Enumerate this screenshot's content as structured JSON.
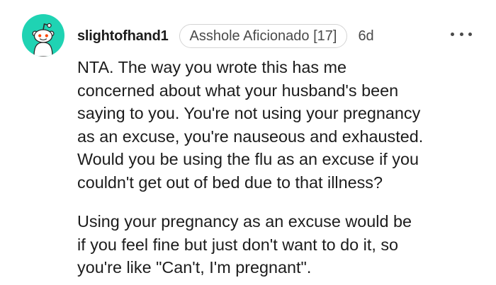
{
  "comment": {
    "author": "slightofhand1",
    "flair": "Asshole Aficionado [17]",
    "age": "6d",
    "more_icon": "more-options-icon",
    "avatar_icon": "snoo-avatar-icon",
    "avatar_color": "#1fd3b3",
    "paragraphs": [
      {
        "lines": [
          "NTA. The way you wrote this has me",
          "concerned about what your husband's been",
          "saying to you. You're not using your pregnancy",
          "as an excuse, you're nauseous and exhausted.",
          "Would you be using the flu as an excuse if you",
          "couldn't get out of bed due to that illness?"
        ]
      },
      {
        "lines": [
          "Using your pregnancy as an excuse would be",
          "if you feel fine but just don't want to do it, so",
          "you're like \"Can't, I'm pregnant\"."
        ]
      }
    ]
  }
}
